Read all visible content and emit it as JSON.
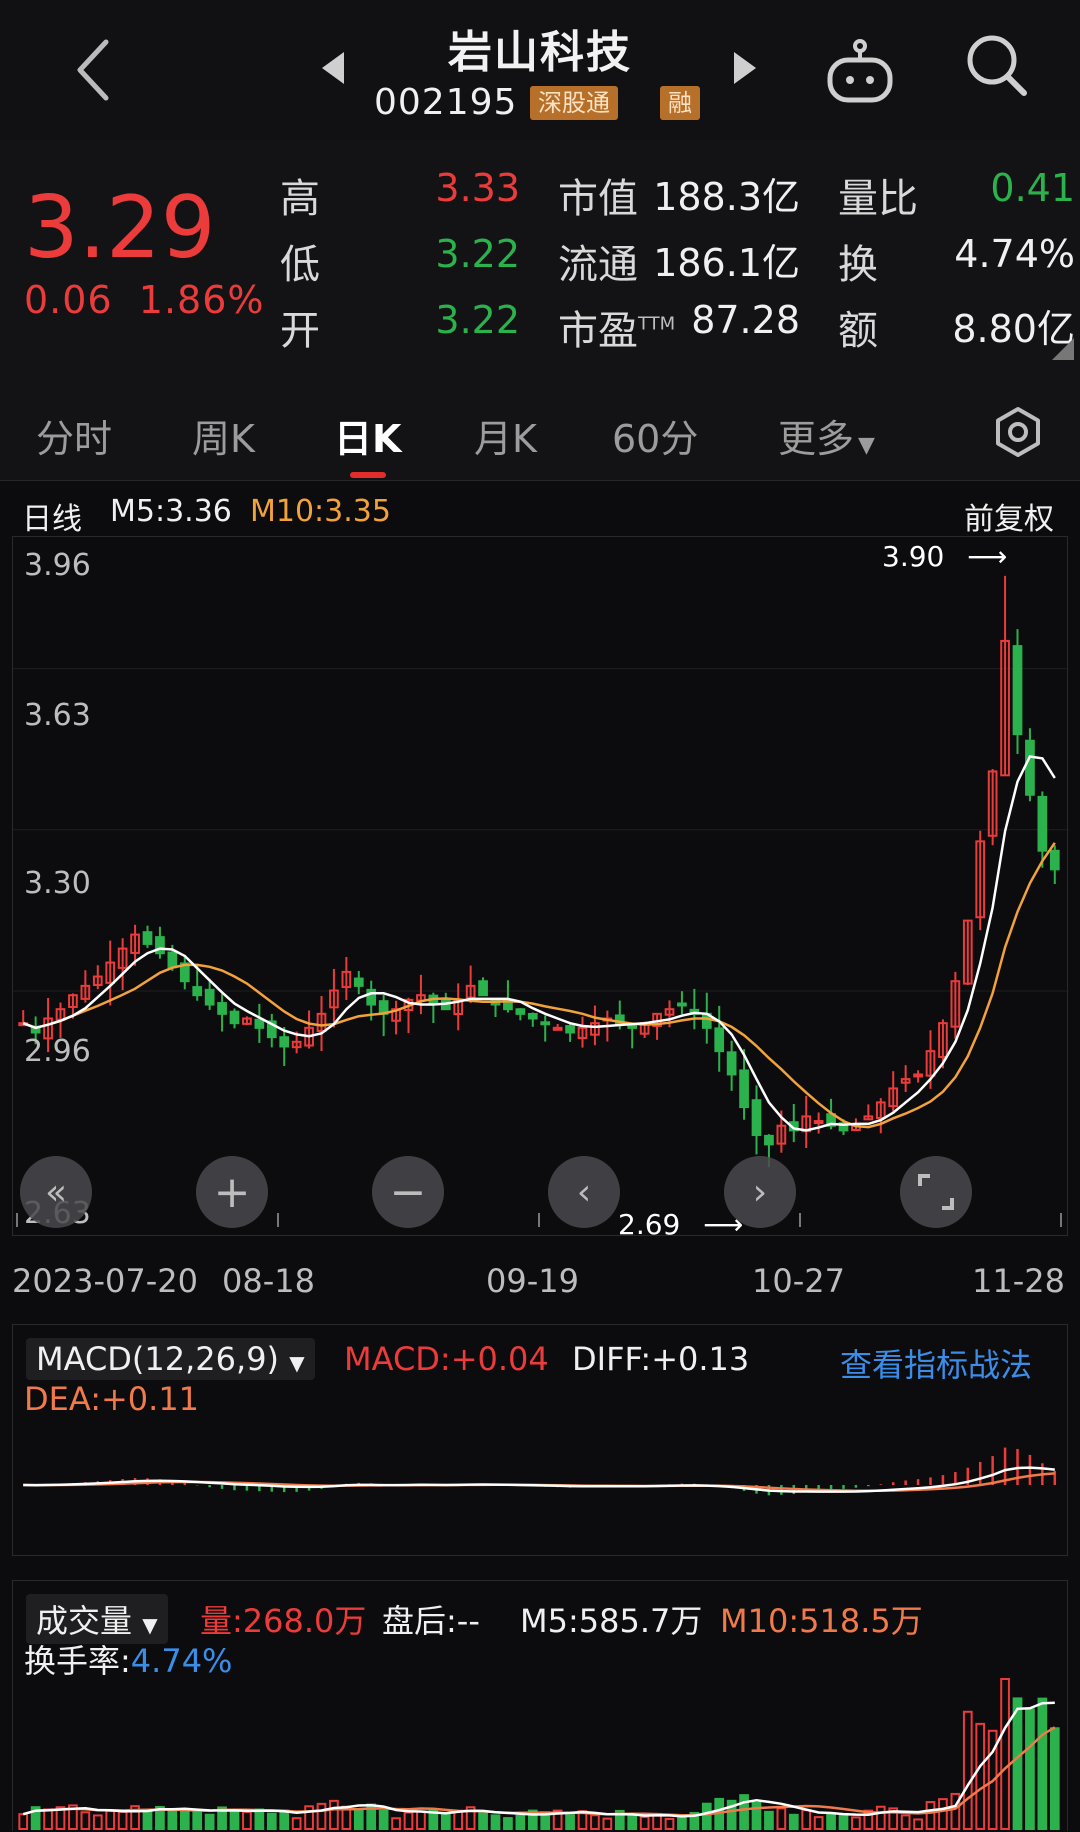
{
  "header": {
    "stock_name": "岩山科技",
    "stock_code": "002195",
    "hk_connect_badge": "深股通",
    "margin_badge": "融"
  },
  "quote": {
    "price": "3.29",
    "change": "0.06",
    "change_pct": "1.86%",
    "high_label": "高",
    "high": "3.33",
    "low_label": "低",
    "low": "3.22",
    "open_label": "开",
    "open": "3.22",
    "mktcap_label": "市值",
    "mktcap": "188.3亿",
    "float_label": "流通",
    "float": "186.1亿",
    "pe_label": "市盈",
    "pe_sup": "TTM",
    "pe": "87.28",
    "vol_ratio_label": "量比",
    "vol_ratio": "0.41",
    "turnover_label": "换",
    "turnover": "4.74%",
    "amount_label": "额",
    "amount": "8.80亿"
  },
  "tabs": [
    {
      "label": "分时"
    },
    {
      "label": "周K"
    },
    {
      "label": "日K"
    },
    {
      "label": "月K"
    },
    {
      "label": "60分"
    },
    {
      "label": "更多"
    }
  ],
  "kline": {
    "period_label": "日线",
    "ma5": "M5:3.36",
    "ma10": "M10:3.35",
    "adjust": "前复权",
    "y_ticks": [
      "3.96",
      "3.63",
      "3.30",
      "2.96",
      "2.63"
    ],
    "high_marker": "3.90",
    "low_marker": "2.69",
    "dates": [
      "2023-07-20",
      "08-18",
      "09-19",
      "10-27",
      "11-28"
    ]
  },
  "macd": {
    "indicator": "MACD(12,26,9)",
    "macd": "MACD:+0.04",
    "diff": "DIFF:+0.13",
    "dea": "DEA:+0.11",
    "link": "查看指标战法"
  },
  "volume": {
    "indicator": "成交量",
    "vol": "量:268.0万",
    "after_hours": "盘后:--",
    "m5": "M5:585.7万",
    "m10": "M10:518.5万",
    "turnover_label": "换手率:",
    "turnover_value": "4.74%"
  },
  "colors": {
    "up": "#ec3b3b",
    "down": "#2bb24c",
    "ma5": "#ffffff",
    "ma10": "#f2a23a",
    "badge": "#b7702a",
    "link": "#3b8ee8"
  },
  "chart_data": {
    "type": "candlestick",
    "ylim": [
      2.63,
      3.96
    ],
    "closes": [
      2.96,
      2.94,
      2.97,
      2.99,
      3.02,
      3.04,
      3.06,
      3.09,
      3.12,
      3.15,
      3.13,
      3.11,
      3.08,
      3.05,
      3.02,
      3.0,
      2.98,
      2.96,
      2.97,
      2.95,
      2.93,
      2.91,
      2.92,
      2.95,
      2.98,
      3.03,
      3.07,
      3.04,
      3.0,
      2.98,
      2.99,
      3.01,
      3.02,
      3.0,
      2.99,
      3.01,
      3.04,
      3.02,
      3.0,
      2.99,
      2.98,
      2.97,
      2.96,
      2.95,
      2.94,
      2.95,
      2.96,
      2.97,
      2.96,
      2.95,
      2.96,
      2.98,
      2.99,
      3.0,
      2.98,
      2.95,
      2.9,
      2.85,
      2.78,
      2.72,
      2.7,
      2.74,
      2.73,
      2.76,
      2.75,
      2.74,
      2.73,
      2.74,
      2.76,
      2.79,
      2.82,
      2.84,
      2.85,
      2.9,
      2.96,
      3.05,
      3.18,
      3.35,
      3.5,
      3.78,
      3.58,
      3.45,
      3.33,
      3.29
    ]
  }
}
